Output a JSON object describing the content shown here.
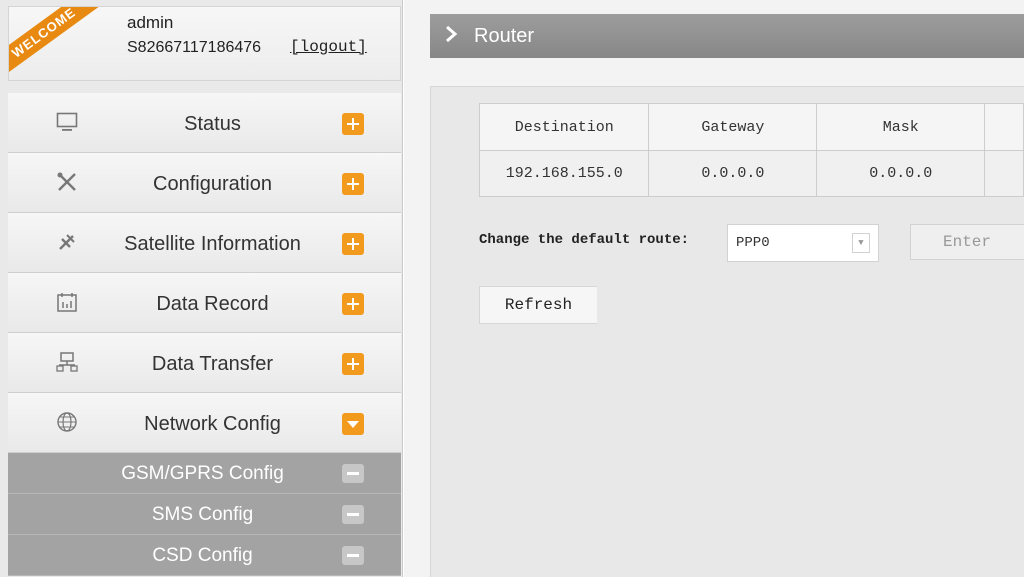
{
  "user": {
    "welcome_ribbon": "WELCOME",
    "name": "admin",
    "serial": "S82667117186476",
    "logout_label": "[logout]"
  },
  "menu": {
    "items": [
      {
        "label": "Status",
        "icon": "monitor-icon",
        "state": "collapsed"
      },
      {
        "label": "Configuration",
        "icon": "tools-icon",
        "state": "collapsed"
      },
      {
        "label": "Satellite Information",
        "icon": "satellite-icon",
        "state": "collapsed"
      },
      {
        "label": "Data Record",
        "icon": "calendar-icon",
        "state": "collapsed"
      },
      {
        "label": "Data Transfer",
        "icon": "network-icon",
        "state": "collapsed"
      },
      {
        "label": "Network Config",
        "icon": "globe-icon",
        "state": "expanded"
      }
    ],
    "subitems": [
      {
        "label": "GSM/GPRS Config"
      },
      {
        "label": "SMS Config"
      },
      {
        "label": "CSD Config"
      }
    ]
  },
  "header": {
    "title": "Router"
  },
  "table": {
    "columns": [
      "Destination",
      "Gateway",
      "Mask",
      ""
    ],
    "rows": [
      [
        "192.168.155.0",
        "0.0.0.0",
        "0.0.0.0",
        ""
      ]
    ]
  },
  "route": {
    "label": "Change the default route:",
    "selected": "PPP0",
    "enter_label": "Enter",
    "refresh_label": "Refresh"
  },
  "colors": {
    "accent": "#f29a1d",
    "header_bar": "#909090",
    "submenu_bg": "#a3a3a3"
  }
}
